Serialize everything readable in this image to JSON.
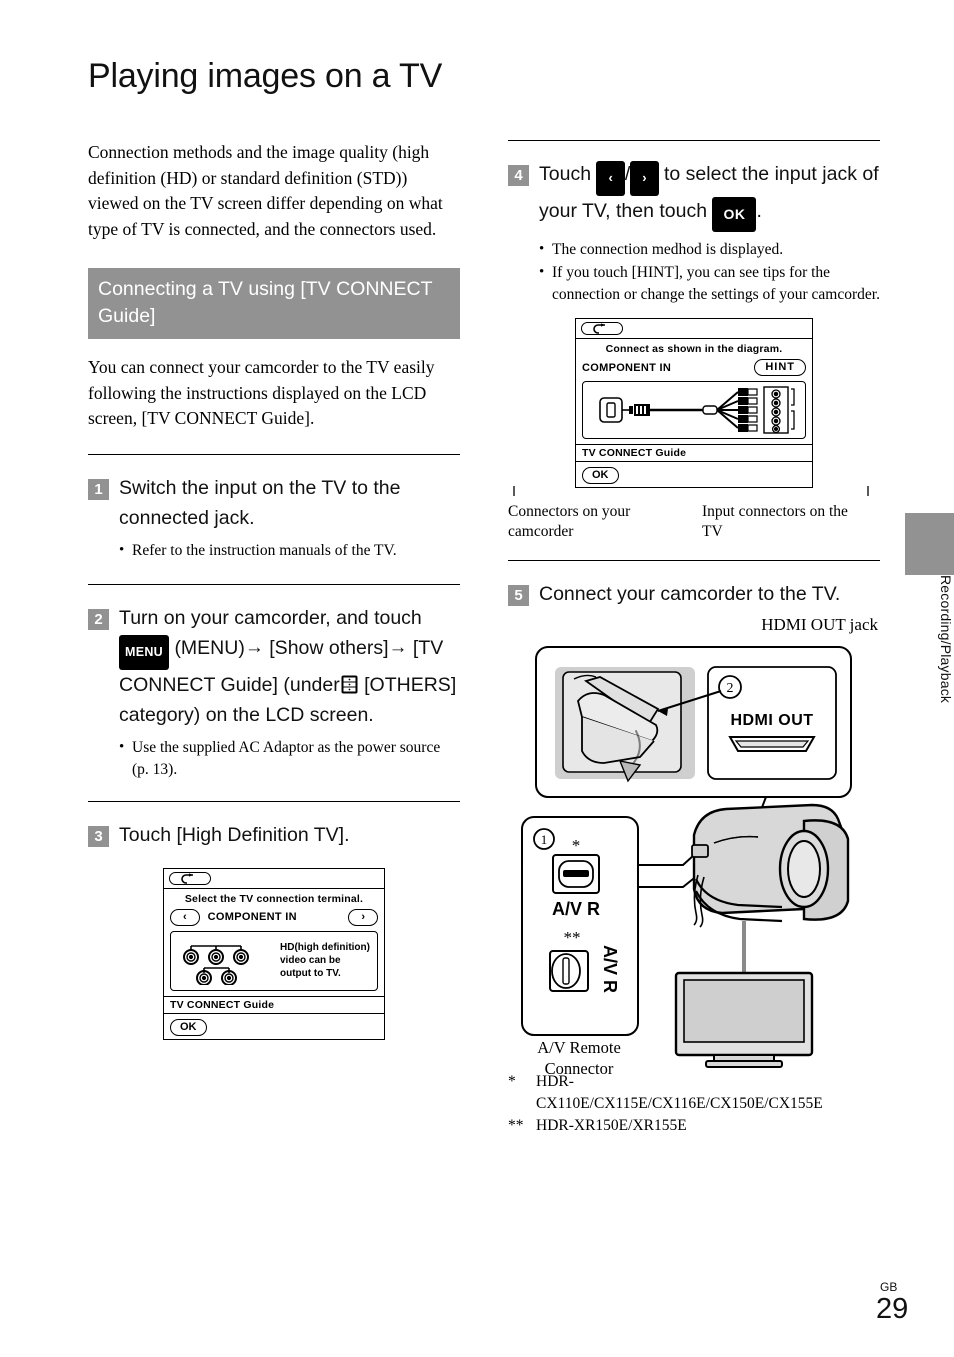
{
  "page": {
    "title": "Playing images on a TV",
    "side_tab_label": "Recording/Playback",
    "page_region": "GB",
    "page_number": "29"
  },
  "left_column": {
    "intro_paragraph": "Connection methods and the image quality (high definition (HD) or standard definition (STD)) viewed on the TV screen differ depending on what type of TV is connected, and the connectors used.",
    "section_heading": "Connecting a TV using [TV CONNECT Guide]",
    "section_paragraph": "You can connect your camcorder to the TV easily following the instructions displayed on the LCD screen, [TV CONNECT Guide].",
    "steps": [
      {
        "number": "1",
        "heading": "Switch the input on the TV to the connected jack.",
        "bullets": [
          "Refer to the instruction manuals of the TV."
        ]
      },
      {
        "number": "2",
        "heading_part1": "Turn on your camcorder, and touch",
        "menu_icon_label": "MENU",
        "heading_part2": "(MENU)",
        "arrow1": "→",
        "heading_part3": "[Show others]",
        "arrow2": "→",
        "heading_part4": "[TV CONNECT Guide] (under",
        "others_icon_name": "others-category-icon",
        "heading_part5": "[OTHERS] category) on the LCD screen.",
        "bullets": [
          "Use the supplied AC Adaptor as the power source (p. 13)."
        ]
      },
      {
        "number": "3",
        "heading": "Touch [High Definition TV]."
      }
    ],
    "lcd_figure_step3": {
      "back_icon": "back-arrow-icon",
      "title": "Select the TV connection terminal.",
      "prev_arrow": "‹",
      "terminal_label": "COMPONENT IN",
      "next_arrow": "›",
      "description": "HD(high definition) video can be output to TV.",
      "footer": "TV CONNECT Guide",
      "ok_label": "OK"
    }
  },
  "right_column": {
    "steps": [
      {
        "number": "4",
        "heading_part1": "Touch",
        "left_arrow_label": "‹",
        "slash": "/",
        "right_arrow_label": "›",
        "heading_part2": "to select the input jack of your TV, then touch",
        "ok_label": "OK",
        "heading_part3": ".",
        "bullets": [
          "The connection medhod is displayed.",
          "If you touch [HINT], you can see tips for the connection or change the settings of your camcorder."
        ]
      },
      {
        "number": "5",
        "heading": "Connect your camcorder to the TV."
      }
    ],
    "lcd_figure_step4": {
      "back_icon": "back-arrow-icon",
      "title": "Connect as shown in the diagram.",
      "terminal_label": "COMPONENT IN",
      "hint_label": "HINT",
      "footer": "TV CONNECT Guide",
      "ok_label": "OK"
    },
    "figure_captions": {
      "left": "Connectors on your camcorder",
      "right": "Input connectors on the TV"
    },
    "camcorder_figure": {
      "hdmi_caption": "HDMI OUT jack",
      "callout_2": "②",
      "hdmi_port_label": "HDMI OUT",
      "callout_1": "①",
      "avr_label_1": "A/V R",
      "avr_label_2": "A/V R",
      "star_1": "*",
      "star_2": "**",
      "avr_caption": "A/V Remote Connector"
    },
    "footnotes": [
      {
        "mark": "*",
        "text": "HDR-CX110E/CX115E/CX116E/CX150E/CX155E"
      },
      {
        "mark": "**",
        "text": "HDR-XR150E/XR155E"
      }
    ]
  },
  "colors": {
    "accent_gray": "#929292",
    "text": "#000000",
    "illustration_fill": "#d8d8d8"
  }
}
